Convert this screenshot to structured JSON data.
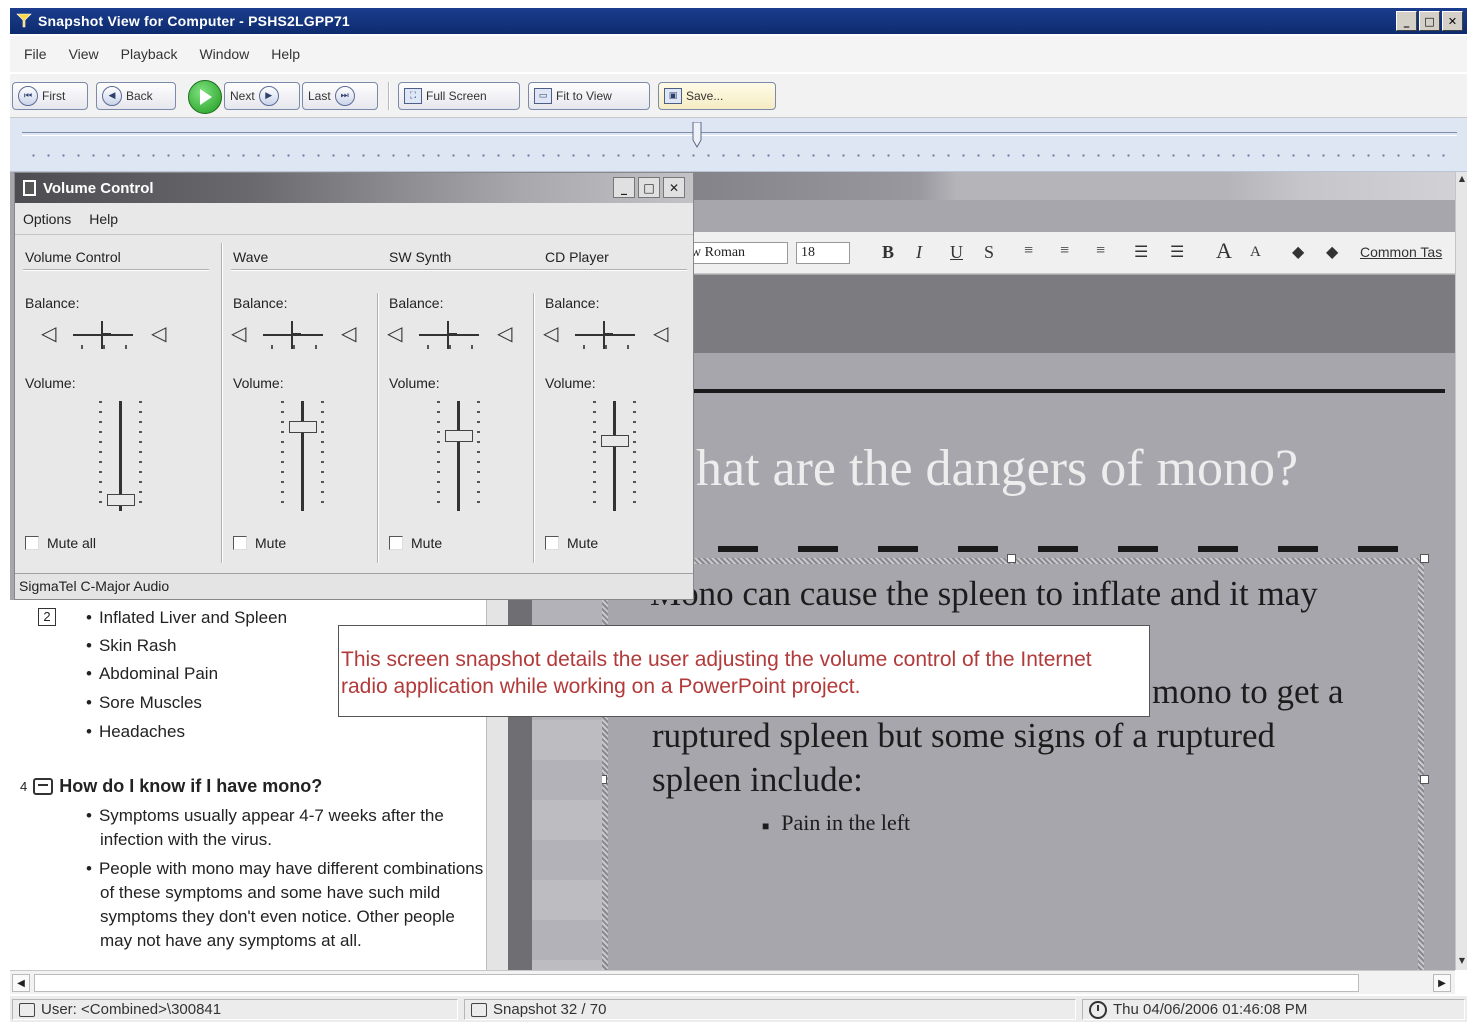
{
  "window": {
    "title": "Snapshot View for Computer - PSHS2LGPP71",
    "controls": {
      "minimize": "_",
      "maximize": "□",
      "close": "✕"
    }
  },
  "menu": [
    "File",
    "View",
    "Playback",
    "Window",
    "Help"
  ],
  "toolbar": {
    "first": "First",
    "back": "Back",
    "next": "Next",
    "last": "Last",
    "full_screen": "Full Screen",
    "fit_to_view": "Fit to View",
    "save": "Save..."
  },
  "timeline": {
    "position_fraction": 0.47
  },
  "volume_control": {
    "title": "Volume Control",
    "menu": [
      "Options",
      "Help"
    ],
    "balance_label": "Balance:",
    "volume_label": "Volume:",
    "channels": [
      {
        "name": "Volume Control",
        "mute_label": "Mute all",
        "volume_level": 0.05
      },
      {
        "name": "Wave",
        "mute_label": "Mute",
        "volume_level": 0.8
      },
      {
        "name": "SW Synth",
        "mute_label": "Mute",
        "volume_level": 0.7
      },
      {
        "name": "CD Player",
        "mute_label": "Mute",
        "volume_level": 0.65
      }
    ],
    "device": "SigmaTel C-Major Audio",
    "window_controls": {
      "minimize": "_",
      "maximize": "□",
      "close": "✕"
    }
  },
  "powerpoint": {
    "font_name": "w Roman",
    "font_size": "18",
    "format_buttons": [
      "B",
      "I",
      "U",
      "S"
    ],
    "common_tasks": "Common Tas",
    "slide_title": "hat are the dangers of mono?",
    "body_lines": [
      "Mono can cause the spleen to inflate and it may",
      "mono to get a",
      "ruptured spleen but some signs of a ruptured",
      "spleen include:"
    ],
    "sub_bullet": "Pain in the left"
  },
  "outline": {
    "slide_number": "2",
    "bullets": [
      "Inflated Liver and Spleen",
      "Skin Rash",
      "Abdominal Pain",
      "Sore Muscles",
      "Headaches"
    ],
    "next_slide_index": "4",
    "next_slide_title": "How do I know if I have mono?",
    "next_slide_bullets": [
      "Symptoms usually appear 4-7 weeks after the infection with the virus.",
      "People with mono may have different combinations of these symptoms and some have such mild symptoms they don't even notice.  Other people may not have any symptoms at all."
    ]
  },
  "caption": "This screen snapshot details the user adjusting the volume control of the Internet radio application while working on a PowerPoint project.",
  "status": {
    "user": "User: <Combined>\\300841",
    "snapshot": "Snapshot 32 / 70",
    "datetime": "Thu 04/06/2006 01:46:08 PM"
  },
  "colors": {
    "title_bar": "#1b3d8d",
    "caption_text": "#b23a3a",
    "play_button": "#1f9a1f"
  }
}
